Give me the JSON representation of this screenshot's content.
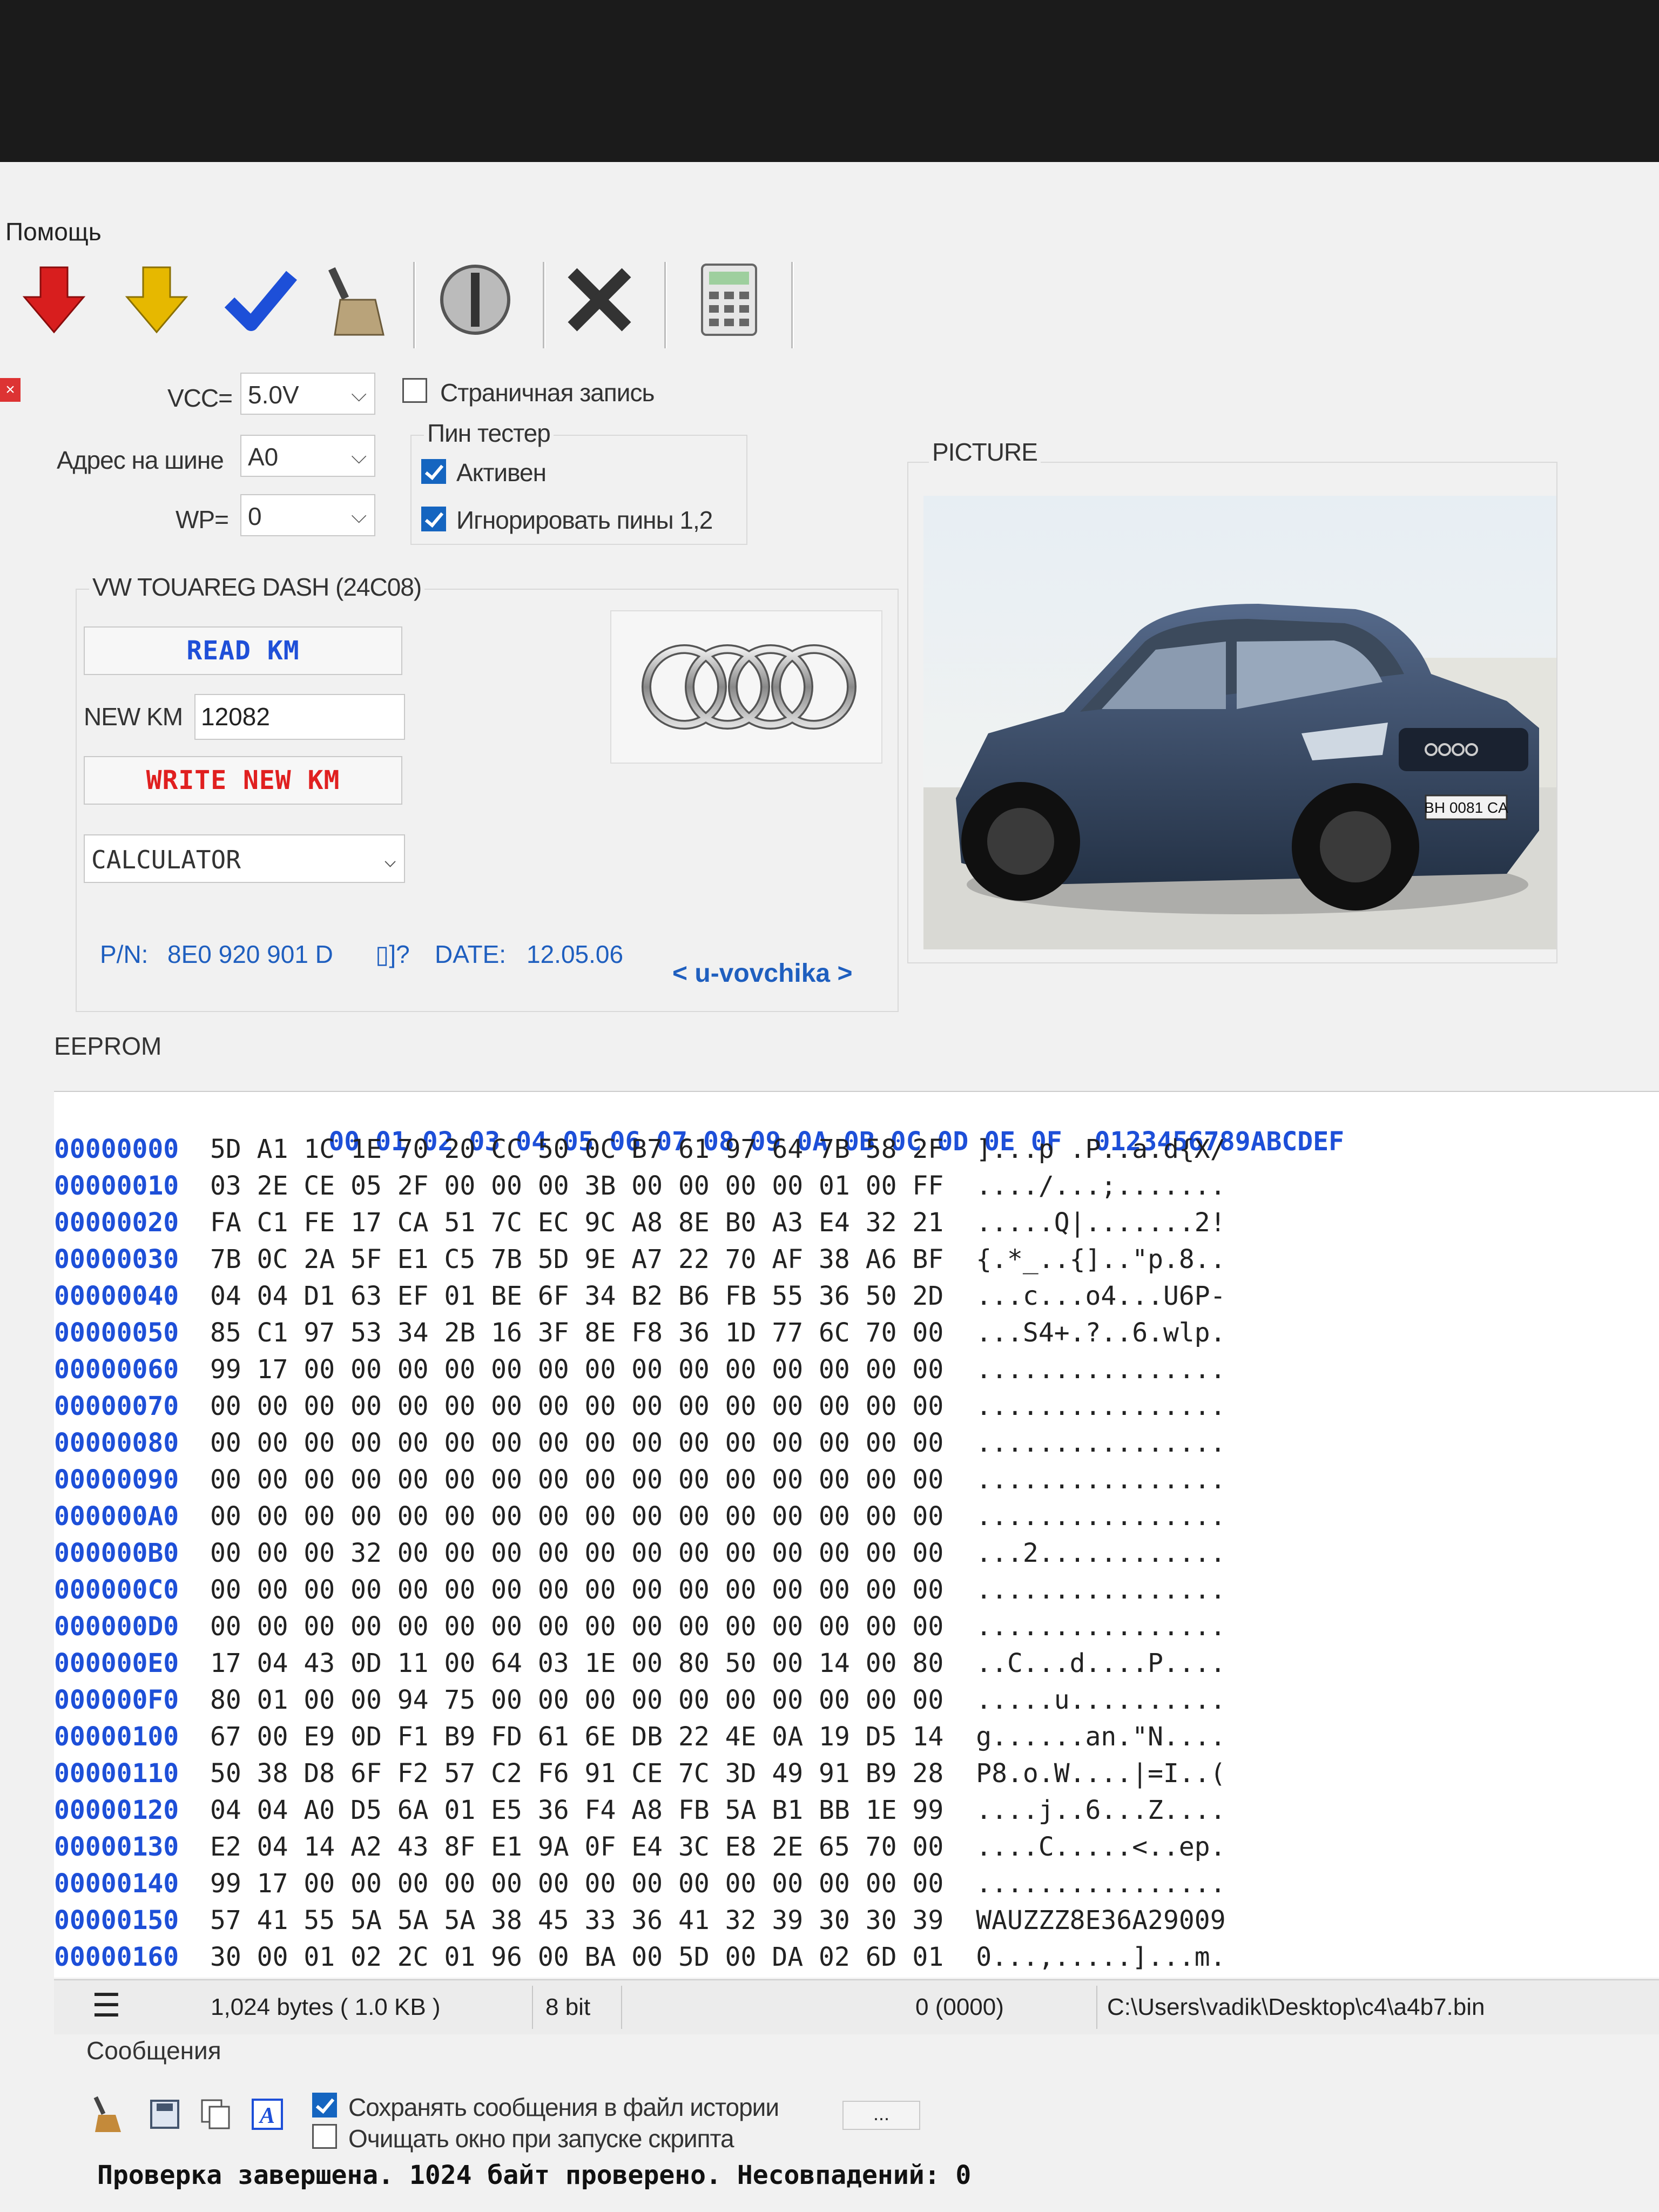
{
  "menu": {
    "help": "Помощь"
  },
  "toolbar": {
    "icons": [
      "read-arrow-icon",
      "write-arrow-icon",
      "verify-check-icon",
      "erase-brush-icon",
      "info-disc-icon",
      "cancel-x-icon",
      "calculator-icon"
    ]
  },
  "settings": {
    "vcc_label": "VCC=",
    "vcc_value": "5.0V",
    "bus_address_label": "Адрес на шине",
    "bus_address_value": "A0",
    "wp_label": "WP=",
    "wp_value": "0",
    "page_write_label": "Страничная запись",
    "pin_tester_title": "Пин тестер",
    "active_label": "Активен",
    "ignore_pins_label": "Игнорировать пины 1,2"
  },
  "vw_panel": {
    "title": "VW TOUAREG DASH (24C08)",
    "read_km": "READ KM",
    "new_km_label": "NEW KM",
    "new_km_value": "12082",
    "write_new_km": "WRITE NEW KM",
    "calculator": "CALCULATOR",
    "pn_label": "P/N:",
    "pn_value": "8E0 920 901 D",
    "unknown_glyph": "▯]?",
    "date_label": "DATE:",
    "date_value": "12.05.06",
    "author": "< u-vovchika >"
  },
  "picture": {
    "title": "PICTURE",
    "plate": "BH 0081 CA"
  },
  "eeprom": {
    "tab": "EEPROM",
    "header_cols": "00 01 02 03 04 05 06 07 08 09 0A 0B 0C 0D 0E 0F",
    "header_ascii": "0123456789ABCDEF",
    "rows": [
      {
        "addr": "00000000",
        "bytes": "5D A1 1C 1E 70 20 CC 50 0C B7 61 97 64 7B 58 2F",
        "ascii": "]...p .P..a.d{X/"
      },
      {
        "addr": "00000010",
        "bytes": "03 2E CE 05 2F 00 00 00 3B 00 00 00 00 01 00 FF",
        "ascii": "..../...;......."
      },
      {
        "addr": "00000020",
        "bytes": "FA C1 FE 17 CA 51 7C EC 9C A8 8E B0 A3 E4 32 21",
        "ascii": ".....Q|.......2!"
      },
      {
        "addr": "00000030",
        "bytes": "7B 0C 2A 5F E1 C5 7B 5D 9E A7 22 70 AF 38 A6 BF",
        "ascii": "{.*_..{]..\"p.8.."
      },
      {
        "addr": "00000040",
        "bytes": "04 04 D1 63 EF 01 BE 6F 34 B2 B6 FB 55 36 50 2D",
        "ascii": "...c...o4...U6P-"
      },
      {
        "addr": "00000050",
        "bytes": "85 C1 97 53 34 2B 16 3F 8E F8 36 1D 77 6C 70 00",
        "ascii": "...S4+.?..6.wlp."
      },
      {
        "addr": "00000060",
        "bytes": "99 17 00 00 00 00 00 00 00 00 00 00 00 00 00 00",
        "ascii": "................"
      },
      {
        "addr": "00000070",
        "bytes": "00 00 00 00 00 00 00 00 00 00 00 00 00 00 00 00",
        "ascii": "................"
      },
      {
        "addr": "00000080",
        "bytes": "00 00 00 00 00 00 00 00 00 00 00 00 00 00 00 00",
        "ascii": "................"
      },
      {
        "addr": "00000090",
        "bytes": "00 00 00 00 00 00 00 00 00 00 00 00 00 00 00 00",
        "ascii": "................"
      },
      {
        "addr": "000000A0",
        "bytes": "00 00 00 00 00 00 00 00 00 00 00 00 00 00 00 00",
        "ascii": "................"
      },
      {
        "addr": "000000B0",
        "bytes": "00 00 00 32 00 00 00 00 00 00 00 00 00 00 00 00",
        "ascii": "...2............"
      },
      {
        "addr": "000000C0",
        "bytes": "00 00 00 00 00 00 00 00 00 00 00 00 00 00 00 00",
        "ascii": "................"
      },
      {
        "addr": "000000D0",
        "bytes": "00 00 00 00 00 00 00 00 00 00 00 00 00 00 00 00",
        "ascii": "................"
      },
      {
        "addr": "000000E0",
        "bytes": "17 04 43 0D 11 00 64 03 1E 00 80 50 00 14 00 80",
        "ascii": "..C...d....P...."
      },
      {
        "addr": "000000F0",
        "bytes": "80 01 00 00 94 75 00 00 00 00 00 00 00 00 00 00",
        "ascii": ".....u.........."
      },
      {
        "addr": "00000100",
        "bytes": "67 00 E9 0D F1 B9 FD 61 6E DB 22 4E 0A 19 D5 14",
        "ascii": "g......an.\"N...."
      },
      {
        "addr": "00000110",
        "bytes": "50 38 D8 6F F2 57 C2 F6 91 CE 7C 3D 49 91 B9 28",
        "ascii": "P8.o.W....|=I..("
      },
      {
        "addr": "00000120",
        "bytes": "04 04 A0 D5 6A 01 E5 36 F4 A8 FB 5A B1 BB 1E 99",
        "ascii": "....j..6...Z...."
      },
      {
        "addr": "00000130",
        "bytes": "E2 04 14 A2 43 8F E1 9A 0F E4 3C E8 2E 65 70 00",
        "ascii": "....C.....<..ep."
      },
      {
        "addr": "00000140",
        "bytes": "99 17 00 00 00 00 00 00 00 00 00 00 00 00 00 00",
        "ascii": "................"
      },
      {
        "addr": "00000150",
        "bytes": "57 41 55 5A 5A 5A 38 45 33 36 41 32 39 30 30 39",
        "ascii": "WAUZZZ8E36A29009"
      },
      {
        "addr": "00000160",
        "bytes": "30 00 01 02 2C 01 96 00 BA 00 5D 00 DA 02 6D 01",
        "ascii": "0...,.....]...m."
      }
    ]
  },
  "statusbar": {
    "size": "1,024 bytes ( 1.0 KB )",
    "bits": "8 bit",
    "offset": "0 (0000)",
    "path": "C:\\Users\\vadik\\Desktop\\c4\\a4b7.bin"
  },
  "messages": {
    "title": "Сообщения",
    "save_history": "Сохранять сообщения в файл истории",
    "clear_window": "Очищать окно при запуске скрипта",
    "ellipsis": "...",
    "last_message": "Проверка завершена. 1024 байт проверено. Несовпадений: 0"
  },
  "colors": {
    "accent_blue": "#1d4fd8",
    "read_blue": "#1f4fd8",
    "write_red": "#e02020"
  }
}
